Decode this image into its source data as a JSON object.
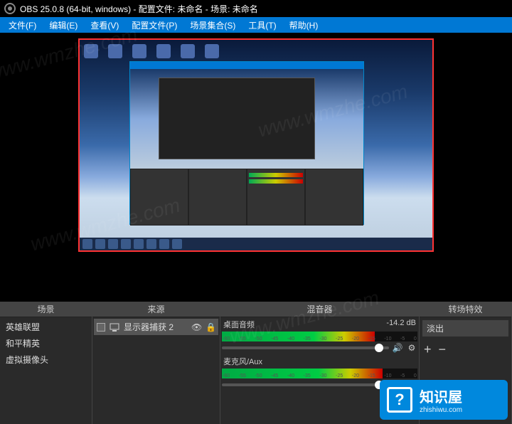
{
  "titlebar": {
    "text": "OBS 25.0.8 (64-bit, windows) - 配置文件: 未命名 - 场景: 未命名"
  },
  "menubar": {
    "file": "文件(F)",
    "edit": "编辑(E)",
    "view": "查看(V)",
    "profile": "配置文件(P)",
    "scene_collection": "场景集合(S)",
    "tools": "工具(T)",
    "help": "帮助(H)"
  },
  "panels": {
    "scenes": {
      "title": "场景",
      "items": [
        "英雄联盟",
        "和平精英",
        "虚拟摄像头"
      ]
    },
    "sources": {
      "title": "来源",
      "items": [
        {
          "label": "显示器捕获 2"
        }
      ]
    },
    "mixer": {
      "title": "混音器",
      "channels": [
        {
          "name": "桌面音频",
          "db": "-14.2 dB",
          "level_pct": 78
        },
        {
          "name": "麦克风/Aux",
          "db": "",
          "level_pct": 82
        }
      ],
      "ticks": [
        "-60",
        "-55",
        "-50",
        "-45",
        "-40",
        "-35",
        "-30",
        "-25",
        "-20",
        "-15",
        "-10",
        "-5",
        "0"
      ]
    },
    "transitions": {
      "title": "转场特效",
      "selected": "淡出",
      "btn_plus": "+",
      "btn_minus": "−"
    }
  },
  "overlay": {
    "brand": "知识屋",
    "domain": "zhishiwu.com",
    "q": "?"
  },
  "watermark": "www.wmzhe.com"
}
